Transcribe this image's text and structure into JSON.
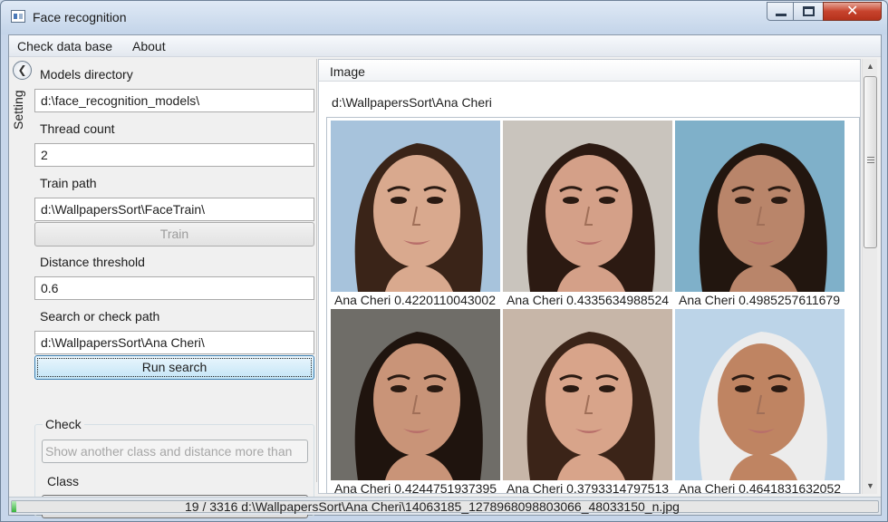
{
  "window": {
    "title": "Face recognition",
    "close_glyph": "✕"
  },
  "menu": {
    "check_db": "Check data base",
    "about": "About"
  },
  "side_panel": {
    "toggle_glyph": "❮",
    "label": "Setting"
  },
  "settings": {
    "models_dir_label": "Models directory",
    "models_dir_value": "d:\\face_recognition_models\\",
    "thread_count_label": "Thread count",
    "thread_count_value": "2",
    "train_path_label": "Train path",
    "train_path_value": "d:\\WallpapersSort\\FaceTrain\\",
    "train_button": "Train",
    "distance_label": "Distance threshold",
    "distance_value": "0.6",
    "search_path_label": "Search or check path",
    "search_path_value": "d:\\WallpapersSort\\Ana Cheri\\",
    "run_button": "Run search",
    "check_group_label": "Check",
    "check_button": "Show another class and distance more than",
    "class_label": "Class",
    "class_value": ""
  },
  "image_panel": {
    "header": "Image",
    "current_path": "d:\\WallpapersSort\\Ana Cheri",
    "results": [
      {
        "caption": "Ana Cheri 0.4220110043002",
        "hair": "#3a2418",
        "skin": "#d9a98e",
        "bg": "#a7c3dc"
      },
      {
        "caption": "Ana Cheri 0.4335634988524",
        "hair": "#2c1a12",
        "skin": "#d4a088",
        "bg": "#c9c4bd"
      },
      {
        "caption": "Ana Cheri 0.4985257611679",
        "hair": "#22160f",
        "skin": "#b9856a",
        "bg": "#7fb0c9"
      },
      {
        "caption": "Ana Cheri 0.4244751937395",
        "hair": "#1f140e",
        "skin": "#c99478",
        "bg": "#6f6d68"
      },
      {
        "caption": "Ana Cheri 0.3793314797513",
        "hair": "#3b2418",
        "skin": "#d8a48a",
        "bg": "#c7b6a8"
      },
      {
        "caption": "Ana Cheri 0.4641831632052",
        "hair": "#ececec",
        "skin": "#bf8462",
        "bg": "#bcd4e8"
      }
    ]
  },
  "status": {
    "text": "19 / 3316  d:\\WallpapersSort\\Ana Cheri\\14063185_1278968098803066_48033150_n.jpg",
    "progress": 0.0057
  }
}
